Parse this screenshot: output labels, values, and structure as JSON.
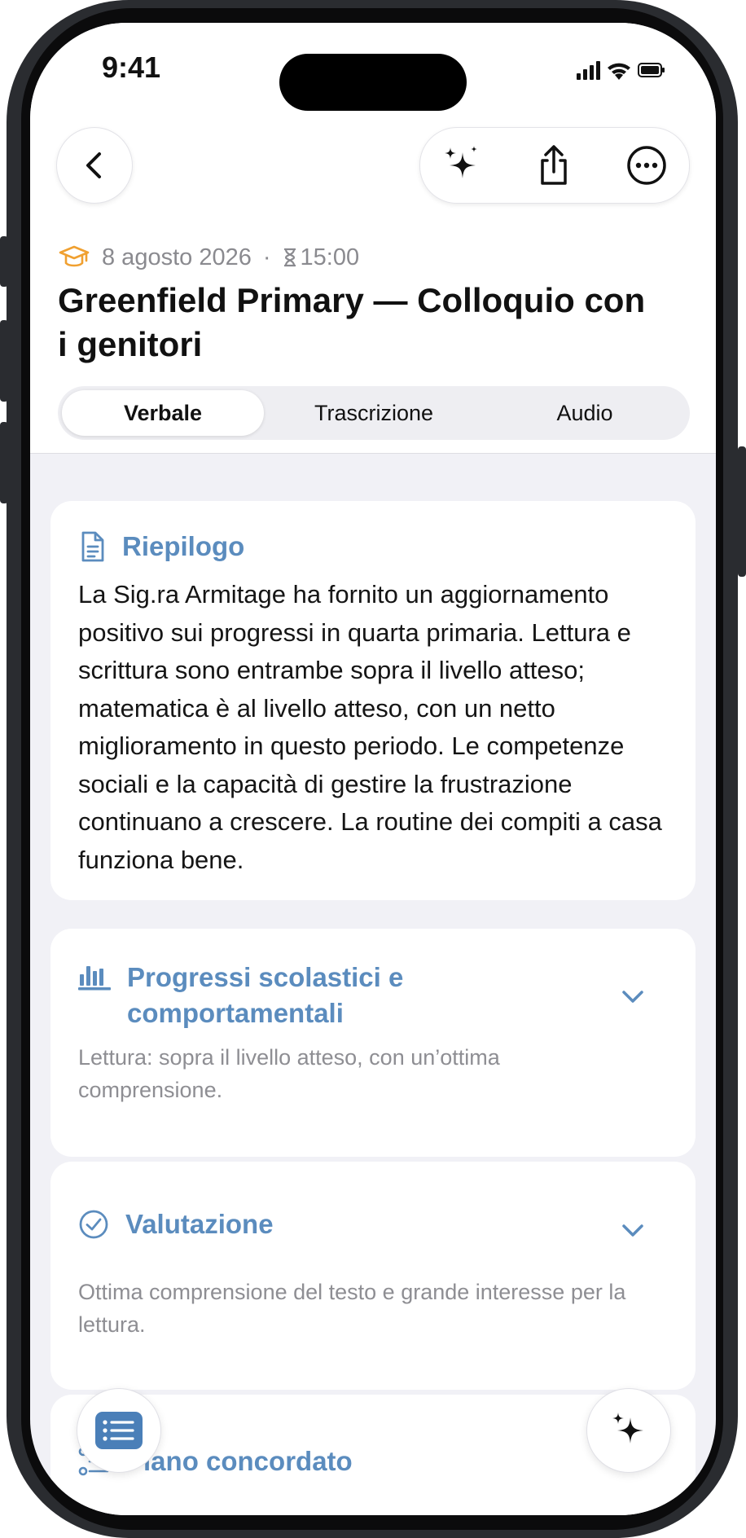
{
  "status_bar": {
    "time": "9:41"
  },
  "meeting": {
    "date": "8 agosto 2026",
    "separator": "·",
    "time": "15:00",
    "title": "Greenfield Primary — Colloquio con i genitori"
  },
  "tabs": [
    {
      "label": "Verbale",
      "active": true
    },
    {
      "label": "Trascrizione",
      "active": false
    },
    {
      "label": "Audio",
      "active": false
    }
  ],
  "summary": {
    "heading": "Riepilogo",
    "text": "La Sig.ra Armitage ha fornito un aggiornamento positivo sui progressi in quarta primaria. Lettura e scrittura sono entrambe sopra il livello atteso; matematica è al livello atteso, con un netto miglioramento in questo periodo. Le competenze sociali e la capacità di gestire la frustrazione continuano a crescere. La routine dei compiti a casa funziona bene."
  },
  "sections": [
    {
      "heading": "Progressi scolastici e comportamentali",
      "preview": "Lettura: sopra il livello atteso, con un’ottima comprensione."
    },
    {
      "heading": "Valutazione",
      "preview": "Ottima comprensione del testo e grande interesse per la lettura."
    },
    {
      "heading": "Piano concordato"
    }
  ],
  "colors": {
    "accent": "#5b8cbe",
    "meeting_icon": "#f0a030",
    "fab_notes": "#4a7fb8"
  },
  "icons": {
    "back": "chevron-left-icon",
    "ai": "sparkles-icon",
    "share": "share-icon",
    "more": "ellipsis-circle-icon",
    "meeting_type": "graduation-cap-icon",
    "duration": "hourglass-icon",
    "summary": "document-icon",
    "progress": "bar-chart-icon",
    "evaluation": "checkmark-circle-icon",
    "plan": "list-icon"
  }
}
